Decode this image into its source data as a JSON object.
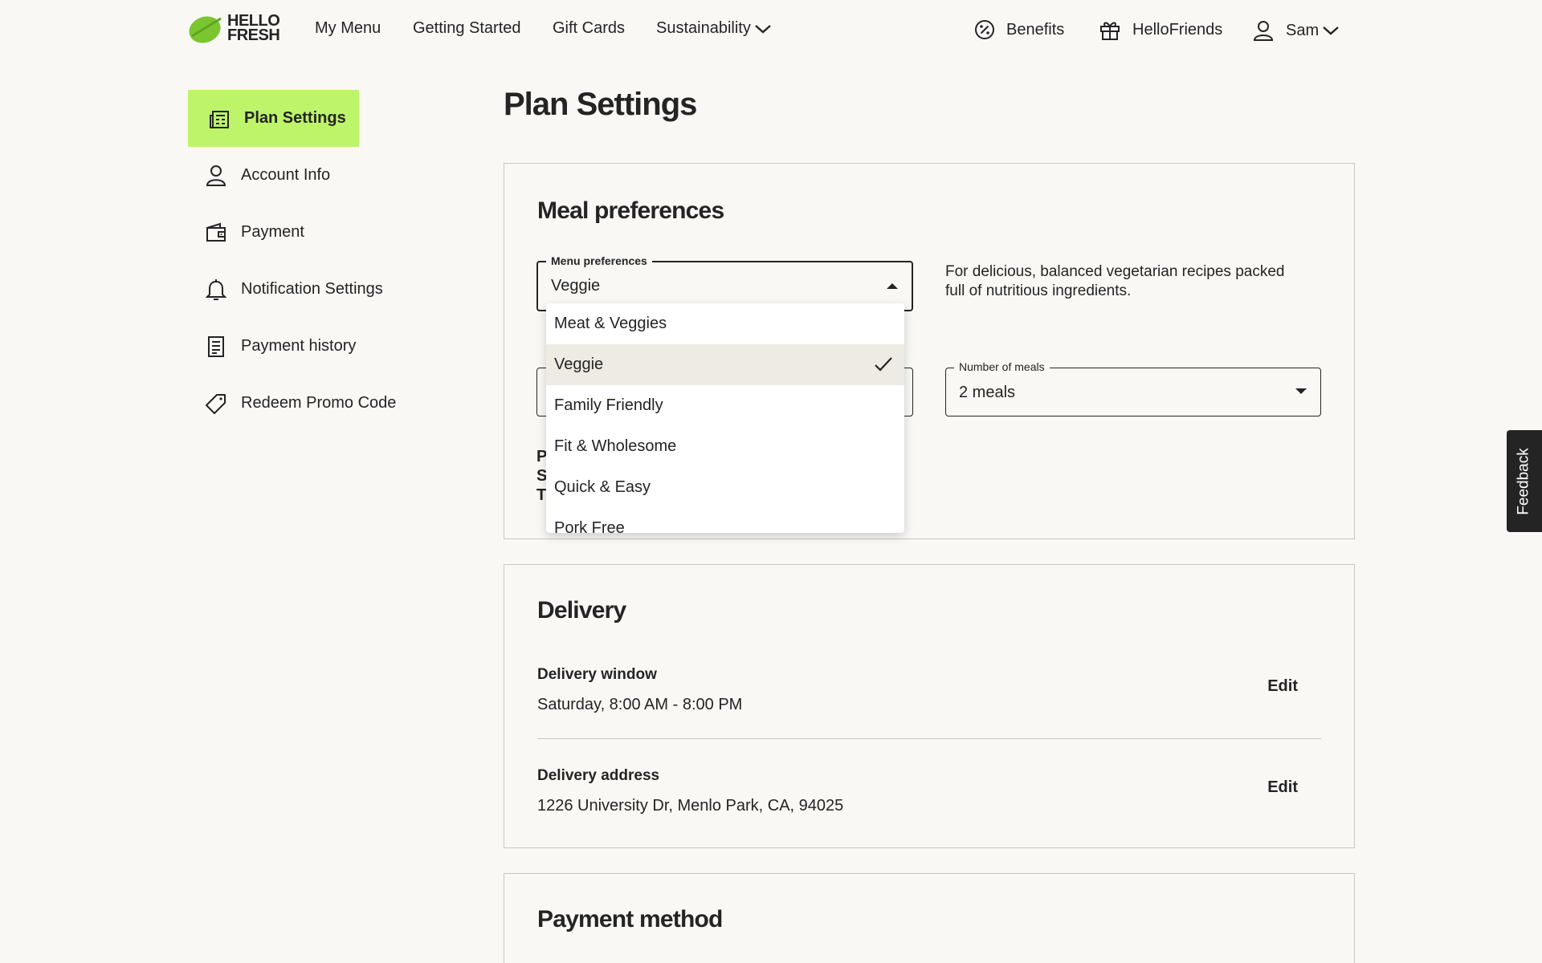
{
  "logo": {
    "line1": "HELLO",
    "line2": "FRESH",
    "brand_color": "#7bc531"
  },
  "nav": {
    "my_menu": "My Menu",
    "getting_started": "Getting Started",
    "gift_cards": "Gift Cards",
    "sustainability": "Sustainability",
    "benefits": "Benefits",
    "hello_friends": "HelloFriends",
    "user": "Sam"
  },
  "sidebar": {
    "items": [
      {
        "label": "Plan Settings",
        "icon": "plan-settings-icon",
        "active": true
      },
      {
        "label": "Account Info",
        "icon": "person-icon"
      },
      {
        "label": "Payment",
        "icon": "wallet-icon"
      },
      {
        "label": "Notification Settings",
        "icon": "bell-icon"
      },
      {
        "label": "Payment history",
        "icon": "receipt-icon"
      },
      {
        "label": "Redeem Promo Code",
        "icon": "tag-icon"
      }
    ],
    "active_color": "#bdf46a"
  },
  "page": {
    "title": "Plan Settings"
  },
  "meal_preferences": {
    "title": "Meal preferences",
    "menu_field": {
      "legend": "Menu preferences",
      "value": "Veggie"
    },
    "description": "For delicious, balanced vegetarian recipes packed full of nutritious ingredients.",
    "meals_field": {
      "legend": "Number of meals",
      "value": "2 meals"
    },
    "peek_letters": [
      "P",
      "S",
      "T"
    ],
    "options": [
      {
        "label": "Meat & Veggies",
        "selected": false
      },
      {
        "label": "Veggie",
        "selected": true
      },
      {
        "label": "Family Friendly",
        "selected": false
      },
      {
        "label": "Fit & Wholesome",
        "selected": false
      },
      {
        "label": "Quick & Easy",
        "selected": false
      },
      {
        "label": "Pork Free",
        "selected": false
      }
    ]
  },
  "delivery": {
    "title": "Delivery",
    "window_label": "Delivery window",
    "window_value": "Saturday, 8:00 AM - 8:00 PM",
    "address_label": "Delivery address",
    "address_value": "1226 University Dr, Menlo Park, CA, 94025",
    "edit": "Edit"
  },
  "payment_method": {
    "title": "Payment method"
  },
  "feedback": "Feedback"
}
